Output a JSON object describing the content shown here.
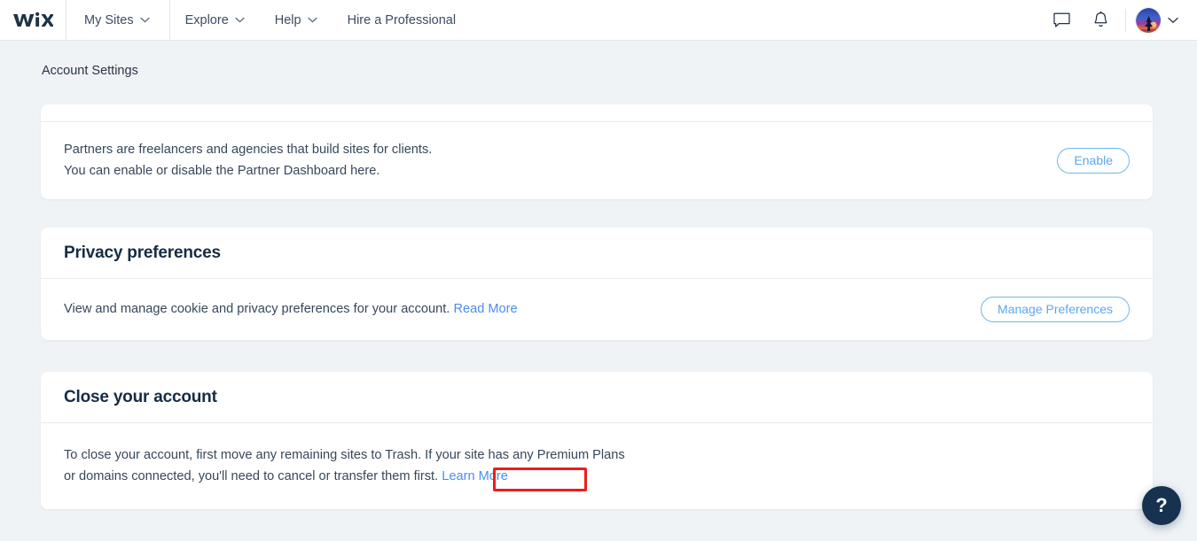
{
  "topnav": {
    "logo_text": "WiX",
    "items": [
      {
        "label": "My Sites",
        "has_chevron": true
      },
      {
        "label": "Explore",
        "has_chevron": true
      },
      {
        "label": "Help",
        "has_chevron": true
      },
      {
        "label": "Hire a Professional",
        "has_chevron": false
      }
    ],
    "icons": {
      "chat": "chat-bubble-icon",
      "notifications": "bell-icon",
      "avatar": "user-avatar",
      "avatar_chevron": "chevron-down-icon"
    }
  },
  "subheader": {
    "title": "Account Settings"
  },
  "cards": {
    "partners": {
      "line1": "Partners are freelancers and agencies that build sites for clients.",
      "line2": "You can enable or disable the Partner Dashboard here.",
      "button": "Enable"
    },
    "privacy": {
      "title": "Privacy preferences",
      "text": "View and manage cookie and privacy preferences for your account.",
      "link": "Read More",
      "button": "Manage Preferences"
    },
    "close_account": {
      "title": "Close your account",
      "line1": "To close your account, first move any remaining sites to Trash. If your site has any Premium Plans",
      "line2": "or domains connected, you'll need to cancel or transfer them first.",
      "link": "Learn More"
    }
  },
  "help": {
    "label": "?"
  },
  "colors": {
    "page_background": "#eff3f6",
    "card_background": "#ffffff",
    "link_blue": "#4a8df0",
    "button_blue": "#5ba7ee",
    "heading_navy": "#152c45",
    "body_text": "#37475b",
    "annotation_red": "#ee1c1c",
    "help_navy": "#16324f"
  }
}
